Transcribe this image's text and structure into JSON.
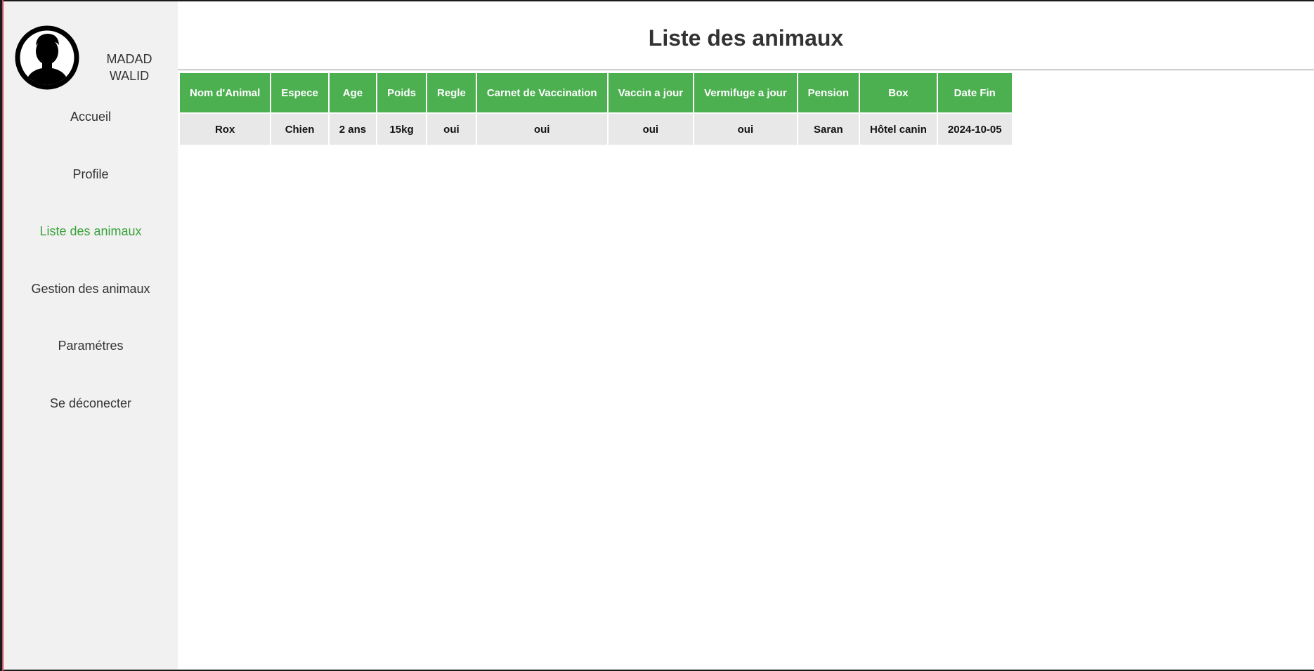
{
  "user": {
    "name_line1": "MADAD",
    "name_line2": "WALID",
    "avatar_icon": "user-silhouette-icon"
  },
  "sidebar": {
    "items": [
      {
        "label": "Accueil",
        "active": false
      },
      {
        "label": "Profile",
        "active": false
      },
      {
        "label": "Liste des animaux",
        "active": true
      },
      {
        "label": "Gestion des animaux",
        "active": false
      },
      {
        "label": "Paramétres",
        "active": false
      },
      {
        "label": "Se déconecter",
        "active": false
      }
    ]
  },
  "main": {
    "title": "Liste des animaux"
  },
  "table": {
    "headers": [
      "Nom d'Animal",
      "Espece",
      "Age",
      "Poids",
      "Regle",
      "Carnet de Vaccination",
      "Vaccin a jour",
      "Vermifuge a jour",
      "Pension",
      "Box",
      "Date Fin"
    ],
    "rows": [
      [
        "Rox",
        "Chien",
        "2 ans",
        "15kg",
        "oui",
        "oui",
        "oui",
        "oui",
        "Saran",
        "Hôtel canin",
        "2024-10-05"
      ]
    ]
  },
  "colors": {
    "header_bg": "#4caf50",
    "active_nav": "#3aa23a",
    "sidebar_bg": "#f1f1f1",
    "cell_bg": "#e8e8e8"
  }
}
